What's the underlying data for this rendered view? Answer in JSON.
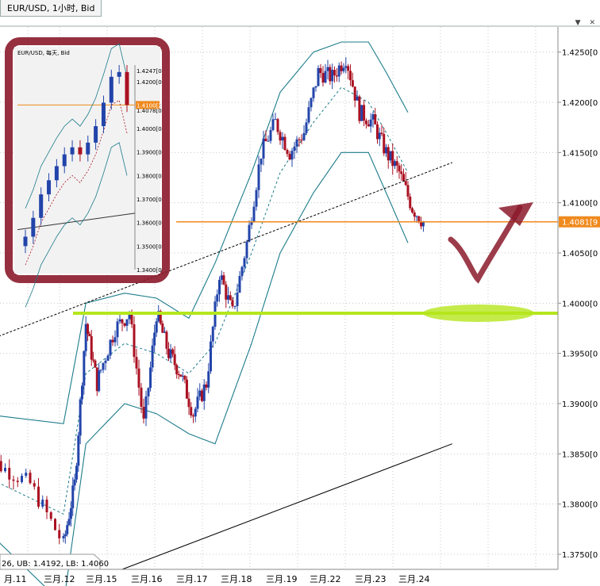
{
  "tab": {
    "title": "EUR/USD, 1小时, Bid"
  },
  "window_buttons": "▼ ✕",
  "status_overlay": "26, UB: 1.4192, LB: 1.4060",
  "colors": {
    "bull": "#2244aa",
    "bear": "#aa1122",
    "band": "#1b7b8a",
    "price_line": "#f08a1e",
    "support": "#b5e61d",
    "frame": "#8b1a2b",
    "arrow": "#8b1a2b"
  },
  "chart_data": [
    {
      "type": "line",
      "title": "",
      "instrument": "EUR/USD, 1小时, Bid",
      "y_ticks": [
        "1.4250[0",
        "1.4200[0",
        "1.4150[0",
        "1.4100[0",
        "1.4050[0",
        "1.4000[0",
        "1.3950[0",
        "1.3900[0",
        "1.3850[0",
        "1.3800[0",
        "1.3750[0"
      ],
      "y_tick_values": [
        1.425,
        1.42,
        1.415,
        1.41,
        1.405,
        1.4,
        1.395,
        1.39,
        1.385,
        1.38,
        1.375
      ],
      "ylim": [
        1.3735,
        1.4275
      ],
      "x_labels": [
        "月.11",
        "三月.12",
        "三月.15",
        "三月.16",
        "三月.17",
        "三月.18",
        "三月.19",
        "三月.22",
        "三月.23",
        "三月.24"
      ],
      "current_price": 1.4081,
      "current_price_label": "1.4081[9",
      "support_level": 1.399,
      "price_path": [
        {
          "x": 0,
          "v": 1.385
        },
        {
          "x": 0.6,
          "v": 1.382
        },
        {
          "x": 1.0,
          "v": 1.376
        },
        {
          "x": 1.3,
          "v": 1.382
        },
        {
          "x": 1.6,
          "v": 1.398
        },
        {
          "x": 1.9,
          "v": 1.392
        },
        {
          "x": 2.3,
          "v": 1.3975
        },
        {
          "x": 2.6,
          "v": 1.399
        },
        {
          "x": 2.9,
          "v": 1.388
        },
        {
          "x": 3.2,
          "v": 1.399
        },
        {
          "x": 3.5,
          "v": 1.395
        },
        {
          "x": 3.8,
          "v": 1.393
        },
        {
          "x": 4.1,
          "v": 1.389
        },
        {
          "x": 4.4,
          "v": 1.392
        },
        {
          "x": 4.7,
          "v": 1.403
        },
        {
          "x": 5.0,
          "v": 1.399
        },
        {
          "x": 5.3,
          "v": 1.406
        },
        {
          "x": 5.6,
          "v": 1.415
        },
        {
          "x": 5.9,
          "v": 1.418
        },
        {
          "x": 6.2,
          "v": 1.415
        },
        {
          "x": 6.5,
          "v": 1.417
        },
        {
          "x": 6.8,
          "v": 1.423
        },
        {
          "x": 7.1,
          "v": 1.4225
        },
        {
          "x": 7.4,
          "v": 1.4245
        },
        {
          "x": 7.7,
          "v": 1.419
        },
        {
          "x": 8.0,
          "v": 1.418
        },
        {
          "x": 8.3,
          "v": 1.415
        },
        {
          "x": 8.6,
          "v": 1.413
        },
        {
          "x": 8.9,
          "v": 1.4095
        },
        {
          "x": 9.15,
          "v": 1.4081
        }
      ],
      "bollinger_upper": [
        {
          "x": 0,
          "v": 1.389
        },
        {
          "x": 1.0,
          "v": 1.388
        },
        {
          "x": 1.6,
          "v": 1.4
        },
        {
          "x": 2.5,
          "v": 1.401
        },
        {
          "x": 3.2,
          "v": 1.4005
        },
        {
          "x": 4.0,
          "v": 1.3985
        },
        {
          "x": 4.6,
          "v": 1.404
        },
        {
          "x": 5.4,
          "v": 1.413
        },
        {
          "x": 6.0,
          "v": 1.421
        },
        {
          "x": 6.7,
          "v": 1.425
        },
        {
          "x": 7.3,
          "v": 1.426
        },
        {
          "x": 7.9,
          "v": 1.426
        },
        {
          "x": 8.3,
          "v": 1.423
        },
        {
          "x": 8.8,
          "v": 1.419
        }
      ],
      "bollinger_middle": [
        {
          "x": 0,
          "v": 1.383
        },
        {
          "x": 1.0,
          "v": 1.379
        },
        {
          "x": 1.6,
          "v": 1.393
        },
        {
          "x": 2.5,
          "v": 1.396
        },
        {
          "x": 3.2,
          "v": 1.395
        },
        {
          "x": 4.0,
          "v": 1.393
        },
        {
          "x": 4.6,
          "v": 1.396
        },
        {
          "x": 5.4,
          "v": 1.405
        },
        {
          "x": 6.0,
          "v": 1.413
        },
        {
          "x": 6.7,
          "v": 1.418
        },
        {
          "x": 7.3,
          "v": 1.4215
        },
        {
          "x": 7.9,
          "v": 1.42
        },
        {
          "x": 8.3,
          "v": 1.417
        },
        {
          "x": 8.8,
          "v": 1.413
        }
      ],
      "bollinger_lower": [
        {
          "x": 0,
          "v": 1.378
        },
        {
          "x": 1.0,
          "v": 1.37
        },
        {
          "x": 1.6,
          "v": 1.386
        },
        {
          "x": 2.5,
          "v": 1.39
        },
        {
          "x": 3.2,
          "v": 1.389
        },
        {
          "x": 4.0,
          "v": 1.387
        },
        {
          "x": 4.6,
          "v": 1.386
        },
        {
          "x": 5.4,
          "v": 1.396
        },
        {
          "x": 6.0,
          "v": 1.405
        },
        {
          "x": 6.7,
          "v": 1.411
        },
        {
          "x": 7.3,
          "v": 1.415
        },
        {
          "x": 7.9,
          "v": 1.415
        },
        {
          "x": 8.3,
          "v": 1.411
        },
        {
          "x": 8.8,
          "v": 1.406
        }
      ],
      "trendline_dashed": [
        {
          "x": 0,
          "v": 1.396
        },
        {
          "x": 9.8,
          "v": 1.414
        }
      ],
      "trendline_solid": [
        {
          "x": 2.45,
          "v": 1.3735
        },
        {
          "x": 9.8,
          "v": 1.386
        }
      ]
    },
    {
      "type": "line",
      "title": "",
      "instrument": "EUR/USD, 每天, Bid",
      "y_ticks": [
        "1.4247[0",
        "1.4200[0",
        "1.4100[2",
        "1.4078[0",
        "1.4000[0",
        "1.3900[0",
        "1.3800[0",
        "1.3700[0",
        "1.3600[0",
        "1.3500[0",
        "1.3400[0"
      ],
      "current_price_label": "1.4100[2",
      "price_path": [
        {
          "x": 0,
          "v": 1.354
        },
        {
          "x": 1,
          "v": 1.362
        },
        {
          "x": 2,
          "v": 1.372
        },
        {
          "x": 3,
          "v": 1.378
        },
        {
          "x": 4,
          "v": 1.384
        },
        {
          "x": 5,
          "v": 1.389
        },
        {
          "x": 6,
          "v": 1.392
        },
        {
          "x": 7,
          "v": 1.389
        },
        {
          "x": 8,
          "v": 1.394
        },
        {
          "x": 9,
          "v": 1.401
        },
        {
          "x": 10,
          "v": 1.411
        },
        {
          "x": 11,
          "v": 1.422
        },
        {
          "x": 12,
          "v": 1.424
        },
        {
          "x": 13,
          "v": 1.41
        }
      ]
    }
  ]
}
